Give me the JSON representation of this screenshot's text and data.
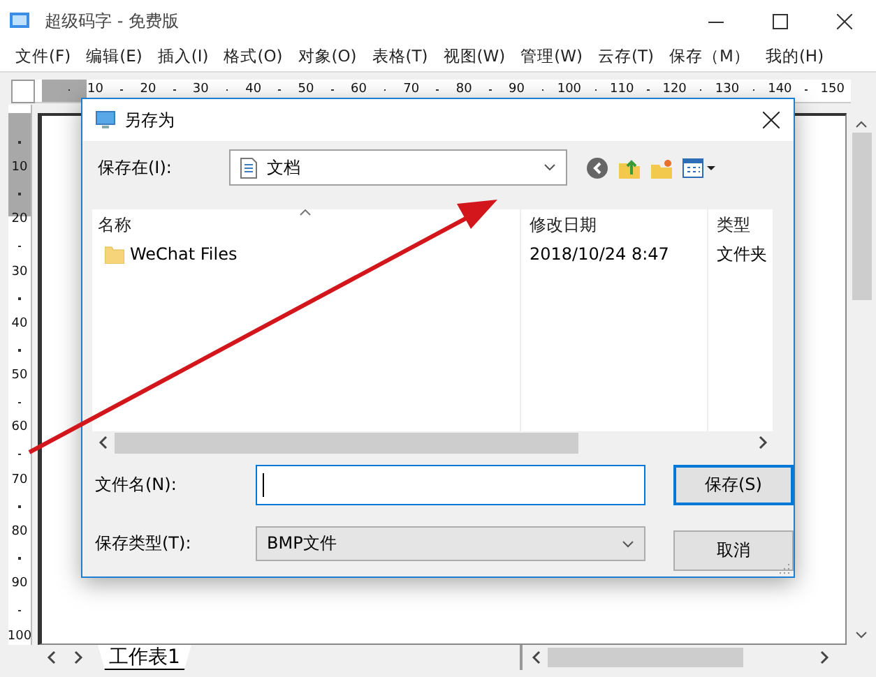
{
  "window": {
    "title": "超级码字 - 免费版"
  },
  "menu": [
    "文件(F)",
    "编辑(E)",
    "插入(I)",
    "格式(O)",
    "对象(O)",
    "表格(T)",
    "视图(W)",
    "管理(W)",
    "云存(T)",
    "保存（M）",
    "我的(H)"
  ],
  "ruler": {
    "horizontal": [
      "10",
      "20",
      "30",
      "40",
      "50",
      "60",
      "70",
      "80",
      "90",
      "100",
      "110",
      "120",
      "130",
      "140",
      "150"
    ],
    "vertical": [
      "10",
      "20",
      "30",
      "40",
      "50",
      "60",
      "70",
      "80",
      "90",
      "100"
    ]
  },
  "sheet_tabs": [
    {
      "label": "工作表1",
      "selected": true
    }
  ],
  "dialog": {
    "title": "另存为",
    "save_in": {
      "label": "保存在(I):",
      "value": "文档"
    },
    "file_list": {
      "columns": [
        "名称",
        "修改日期",
        "类型"
      ],
      "rows": [
        {
          "name": "WeChat Files",
          "modified": "2018/10/24 8:47",
          "type": "文件夹"
        }
      ]
    },
    "file_name": {
      "label": "文件名(N):",
      "focused": true
    },
    "file_type": {
      "label": "保存类型(T):",
      "value": "BMP文件"
    },
    "buttons": [
      {
        "label": "保存(S)",
        "default": true
      },
      {
        "label": "取消",
        "default": false
      }
    ]
  }
}
